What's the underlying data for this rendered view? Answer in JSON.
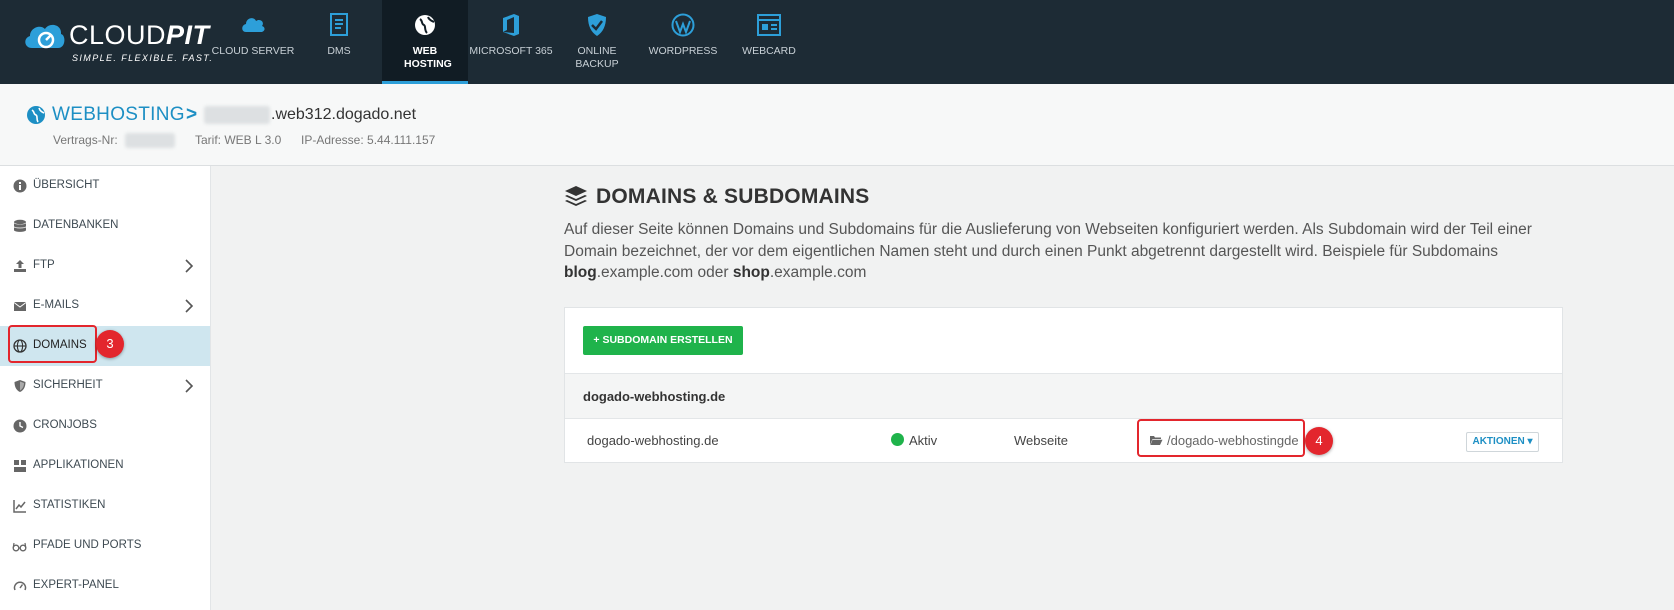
{
  "brand": {
    "name_light": "CLOUD",
    "name_bold": "PIT",
    "tagline": "SIMPLE. FLEXIBLE. FAST."
  },
  "topnav": [
    {
      "label": "CLOUD SERVER",
      "icon": "cloud-icon"
    },
    {
      "label": "DMS",
      "icon": "document-icon"
    },
    {
      "label": "WEB HOSTING",
      "icon": "globe-icon",
      "active": true
    },
    {
      "label": "MICROSOFT 365",
      "icon": "office-icon"
    },
    {
      "label": "ONLINE BACKUP",
      "icon": "shield-check-icon"
    },
    {
      "label": "WORDPRESS",
      "icon": "wordpress-icon"
    },
    {
      "label": "WEBCARD",
      "icon": "webcard-icon"
    }
  ],
  "breadcrumb": {
    "section": "WEBHOSTING",
    "separator": ">",
    "host_suffix": ".web312.dogado.net"
  },
  "meta": {
    "contract_label": "Vertrags-Nr:",
    "tariff": "Tarif: WEB L 3.0",
    "ip": "IP-Adresse: 5.44.111.157"
  },
  "sidebar": {
    "items": [
      {
        "label": "ÜBERSICHT",
        "icon": "info-icon"
      },
      {
        "label": "DATENBANKEN",
        "icon": "database-icon"
      },
      {
        "label": "FTP",
        "icon": "upload-icon",
        "has_submenu": true
      },
      {
        "label": "E-MAILS",
        "icon": "envelope-icon",
        "has_submenu": true
      },
      {
        "label": "DOMAINS",
        "icon": "globe-icon",
        "active": true
      },
      {
        "label": "SICHERHEIT",
        "icon": "shield-icon",
        "has_submenu": true
      },
      {
        "label": "CRONJOBS",
        "icon": "clock-icon"
      },
      {
        "label": "APPLIKATIONEN",
        "icon": "cubes-icon"
      },
      {
        "label": "STATISTIKEN",
        "icon": "line-chart-icon"
      },
      {
        "label": "PFADE UND PORTS",
        "icon": "glasses-icon"
      },
      {
        "label": "EXPERT-PANEL",
        "icon": "gauge-icon"
      }
    ]
  },
  "annotations": {
    "domains_badge": "3",
    "path_badge": "4",
    "highlight_color": "#e3262d"
  },
  "main": {
    "title": "DOMAINS & SUBDOMAINS",
    "desc_part1": "Auf dieser Seite können Domains und Subdomains für die Auslieferung von Webseiten konfiguriert werden. Als Subdomain wird der Teil einer Domain bezeichnet, der vor dem eigentlichen Namen steht und durch einen Punkt abgetrennt dargestellt wird. Beispiele für Subdomains ",
    "desc_ex1_bold": "blog",
    "desc_ex1_rest": ".example.com oder ",
    "desc_ex2_bold": "shop",
    "desc_ex2_rest": ".example.com",
    "create_button": "+ SUBDOMAIN ERSTELLEN",
    "group": "dogado-webhosting.de",
    "row": {
      "domain": "dogado-webhosting.de",
      "status": "Aktiv",
      "type": "Webseite",
      "path": "/dogado-webhostingde",
      "actions": "AKTIONEN ▾"
    }
  },
  "colors": {
    "topbar": "#1d2b35",
    "accent": "#1d8fc4",
    "success": "#1fb34b",
    "active_sidebar": "#cfe6ef"
  }
}
